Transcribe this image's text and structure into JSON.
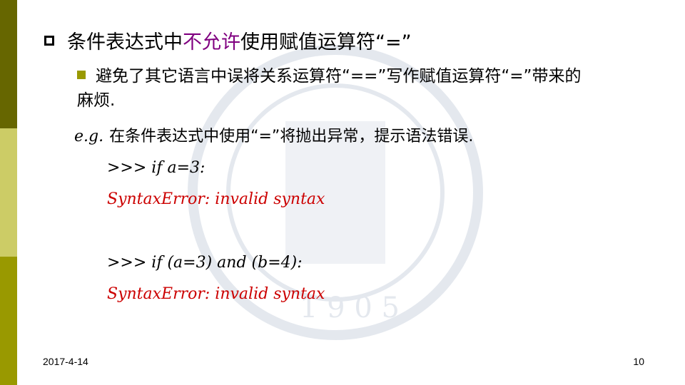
{
  "slide": {
    "heading": {
      "part1": "条件表达式中",
      "highlight": "不允许",
      "part2": "使用赋值运算符“=”"
    },
    "bullet": {
      "line1": "避免了其它语言中误将关系运算符“==”写作赋值运算符“=”带来的",
      "line2": "麻烦."
    },
    "example": {
      "prefix": "e.g.",
      "text": "在条件表达式中使用“=”将抛出异常，提示语法错误."
    },
    "code": [
      {
        "text": ">>> if a=3:",
        "type": "input"
      },
      {
        "text": "SyntaxError: invalid syntax",
        "type": "error"
      },
      {
        "text": ">>> if (a=3) and (b=4):",
        "type": "input"
      },
      {
        "text": "SyntaxError: invalid syntax",
        "type": "error"
      }
    ],
    "footer": {
      "date": "2017-4-14",
      "page": "10"
    },
    "colors": {
      "accent": "#800080",
      "error": "#cc0000",
      "bar_dark": "#666600",
      "bar_light": "#cccc66",
      "bar_mid": "#999900"
    }
  }
}
